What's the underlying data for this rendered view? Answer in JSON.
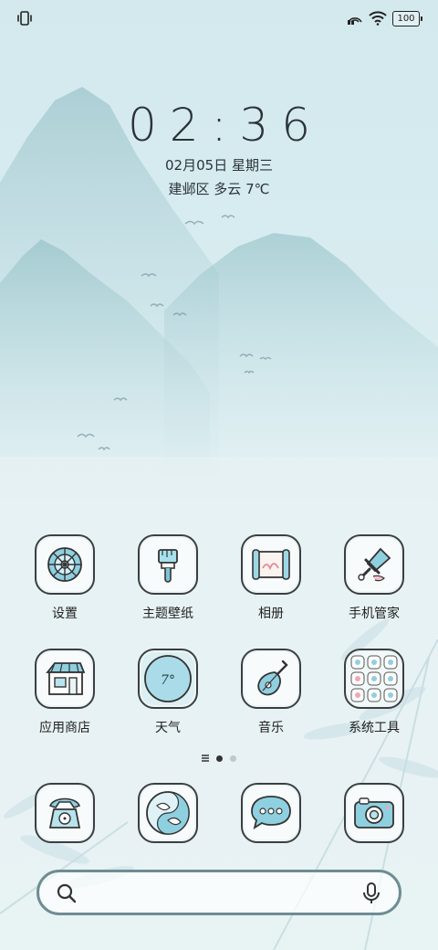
{
  "status_bar": {
    "battery_level": "100"
  },
  "lockscreen": {
    "time": "02:36",
    "date": "02月05日 星期三",
    "weather": "建邺区 多云 7℃"
  },
  "apps": [
    {
      "label": "设置",
      "icon": "settings-wheel-icon"
    },
    {
      "label": "主题壁纸",
      "icon": "paintbrush-icon"
    },
    {
      "label": "相册",
      "icon": "scroll-gallery-icon"
    },
    {
      "label": "手机管家",
      "icon": "sword-guard-icon"
    },
    {
      "label": "应用商店",
      "icon": "shop-house-icon"
    },
    {
      "label": "天气",
      "icon": "weather-circle-icon"
    },
    {
      "label": "音乐",
      "icon": "pipa-music-icon"
    },
    {
      "label": "系统工具",
      "icon": "tools-folder-icon"
    }
  ],
  "weather_widget_text": "7°",
  "page_indicator": {
    "pages": 2,
    "current": 1
  },
  "dock": [
    {
      "icon": "phone-icon"
    },
    {
      "icon": "koi-fish-icon"
    },
    {
      "icon": "message-bubble-icon"
    },
    {
      "icon": "camera-icon"
    }
  ],
  "colors": {
    "accent": "#5fb7cc",
    "sky": "#d3e9ee",
    "mountain": "#9fc9cf",
    "search_border": "#6e8d93"
  }
}
